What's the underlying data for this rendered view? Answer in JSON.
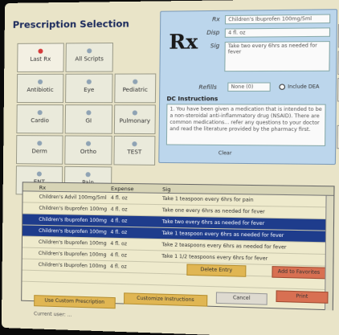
{
  "title": "Prescription Selection",
  "categories": [
    {
      "label": "Last Rx",
      "active": true
    },
    {
      "label": "All Scripts",
      "active": false
    },
    {
      "label": "Antibiotic",
      "active": false
    },
    {
      "label": "Eye",
      "active": false
    },
    {
      "label": "Pediatric",
      "active": false
    },
    {
      "label": "Cardio",
      "active": false
    },
    {
      "label": "GI",
      "active": false
    },
    {
      "label": "Pulmonary",
      "active": false
    },
    {
      "label": "Derm",
      "active": false
    },
    {
      "label": "Ortho",
      "active": false
    },
    {
      "label": "TEST",
      "active": false
    },
    {
      "label": "ENT",
      "active": false
    },
    {
      "label": "Pain",
      "active": false
    }
  ],
  "rx": {
    "symbol": "Rx",
    "rx_label": "Rx",
    "rx_value": "Children's Ibuprofen 100mg/5ml",
    "disp_label": "Disp",
    "disp_value": "4 fl. oz",
    "sig_label": "Sig",
    "sig_value": "Take two every 6hrs as needed for fever",
    "refills_label": "Refills",
    "refills_value": "None (0)",
    "dea_label": "Include DEA",
    "instructions_title": "DC Instructions",
    "instructions_text": "1. You have been given a medication that is intended to be a non-steroidal anti-inflammatory drug (NSAID). There are common medications... refer any questions to your doctor and read the literature provided by the pharmacy first.",
    "clear_label": "Clear"
  },
  "table": {
    "headers": [
      "Rx",
      "Expense",
      "Sig"
    ],
    "rows": [
      {
        "rx": "Children's Advil 100mg/5ml",
        "expense": "4 fl. oz",
        "sig": "Take 1 teaspoon every 6hrs for pain",
        "selected": false
      },
      {
        "rx": "Children's Ibuprofen 100mg",
        "expense": "4 fl. oz",
        "sig": "Take one every 6hrs as needed for fever",
        "selected": false
      },
      {
        "rx": "Children's Ibuprofen 100mg",
        "expense": "4 fl. oz",
        "sig": "Take two every 6hrs as needed for fever",
        "selected": true
      },
      {
        "rx": "Children's Ibuprofen 100mg",
        "expense": "4 fl. oz",
        "sig": "Take 1 teaspoon every 6hrs as needed for fever",
        "selected": true
      },
      {
        "rx": "Children's Ibuprofen 100mg",
        "expense": "4 fl. oz",
        "sig": "Take 2 teaspoons every 6hrs as needed for fever",
        "selected": false
      },
      {
        "rx": "Children's Ibuprofen 100mg",
        "expense": "4 fl. oz",
        "sig": "Take 1 1/2 teaspoons every 6hrs for fever",
        "selected": false
      },
      {
        "rx": "Children's Ibuprofen 100mg",
        "expense": "4 fl. oz",
        "sig": "",
        "selected": false
      },
      {
        "rx": "",
        "expense": "",
        "sig": "",
        "selected": false
      }
    ]
  },
  "buttons": {
    "custom": "Use Custom Prescription",
    "mid_button": "Customize Instructions",
    "right_grey": "Cancel",
    "right_red": "Print",
    "row_action": "Delete Entry",
    "row_action2": "Add to Favorites"
  },
  "caption": "Current user: ..."
}
